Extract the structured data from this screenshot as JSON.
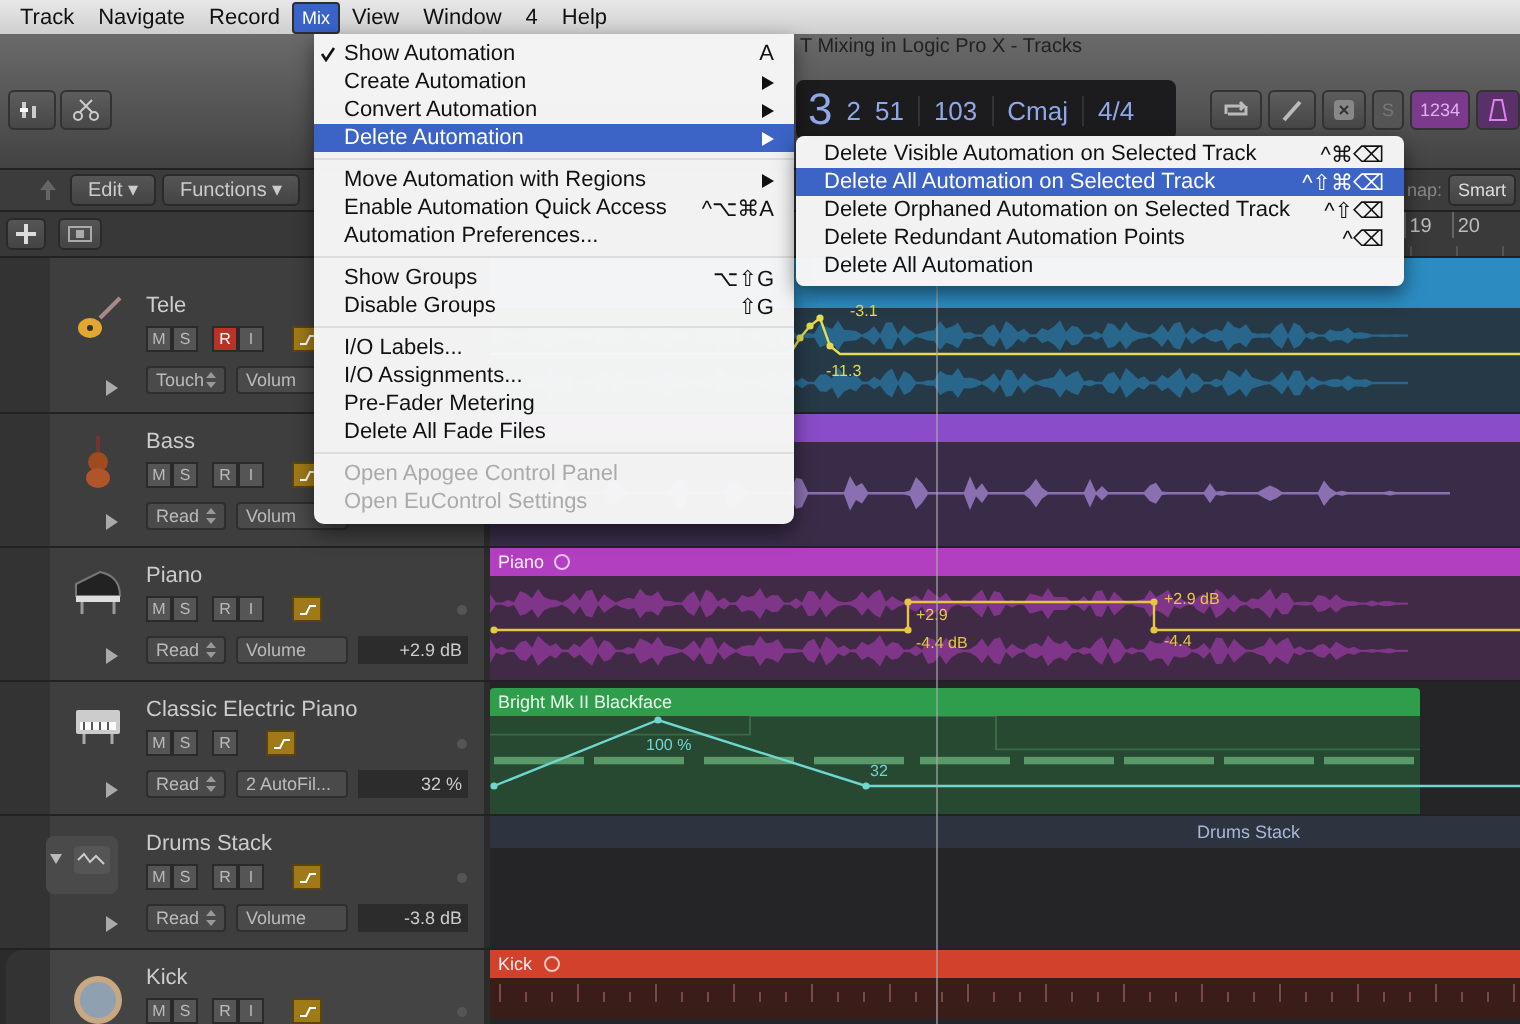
{
  "menu_bar": [
    {
      "label": "Track",
      "selected": false
    },
    {
      "label": "Navigate",
      "selected": false
    },
    {
      "label": "Record",
      "selected": false
    },
    {
      "label": "Mix",
      "selected": true
    },
    {
      "label": "View",
      "selected": false
    },
    {
      "label": "Window",
      "selected": false
    },
    {
      "label": "4",
      "selected": false
    },
    {
      "label": "Help",
      "selected": false
    }
  ],
  "window": {
    "title": "T Mixing in Logic Pro X - Tracks"
  },
  "lcd": {
    "bar": "3",
    "beat": "2",
    "division": "51",
    "tempo": "103",
    "key": "Cmaj",
    "signature": "4/4"
  },
  "toolbar": {
    "solo": "S",
    "count_in": "1234"
  },
  "edit_bar": {
    "menus": [
      "Edit ▾",
      "Functions ▾"
    ],
    "snap_label": "nap:",
    "snap_value": "Smart"
  },
  "ruler": {
    "marks": [
      "19",
      "20"
    ]
  },
  "tracks": [
    {
      "name": "Tele",
      "buttons": [
        {
          "label": "M",
          "on": false
        },
        {
          "label": "S",
          "on": false
        },
        {
          "label": "R",
          "on": true
        },
        {
          "label": "I",
          "on": false
        }
      ],
      "mode": "Touch",
      "parameter": "Volum",
      "region": {
        "kind": "stereo",
        "color": "#2c8cc2"
      },
      "automation_labels": [
        "-3.1",
        "-11.3"
      ]
    },
    {
      "name": "Bass",
      "buttons": [
        {
          "label": "M",
          "on": false
        },
        {
          "label": "S",
          "on": false
        },
        {
          "label": "R",
          "on": false
        },
        {
          "label": "I",
          "on": false
        }
      ],
      "mode": "Read",
      "parameter": "Volum",
      "region": {
        "kind": "mono",
        "color": "#8a4cc8"
      }
    },
    {
      "name": "Piano",
      "buttons": [
        {
          "label": "M",
          "on": false
        },
        {
          "label": "S",
          "on": false
        },
        {
          "label": "R",
          "on": false
        },
        {
          "label": "I",
          "on": false
        }
      ],
      "mode": "Read",
      "parameter": "Volume",
      "value": "+2.9 dB",
      "region": {
        "kind": "stereo",
        "color": "#b23fc0",
        "name": "Piano"
      },
      "automation_labels": [
        "+2.9",
        "-4.4 dB",
        "+2.9 dB",
        "-4.4"
      ]
    },
    {
      "name": "Classic Electric Piano",
      "buttons": [
        {
          "label": "M",
          "on": false
        },
        {
          "label": "S",
          "on": false
        },
        {
          "label": "R",
          "on": false
        }
      ],
      "mode": "Read",
      "parameter": "2 AutoFil...",
      "value": "32 %",
      "region": {
        "kind": "midi",
        "color": "#2f9e4c",
        "name": "Bright Mk II Blackface"
      },
      "automation_labels": [
        "100 %",
        "32"
      ]
    },
    {
      "name": "Drums Stack",
      "expanded": true,
      "buttons": [
        {
          "label": "M",
          "on": false
        },
        {
          "label": "S",
          "on": false
        },
        {
          "label": "R",
          "on": false
        },
        {
          "label": "I",
          "on": false
        }
      ],
      "mode": "Read",
      "parameter": "Volume",
      "value": "-3.8 dB",
      "region": {
        "kind": "summary",
        "name": "Drums Stack"
      }
    },
    {
      "name": "Kick",
      "buttons": [
        {
          "label": "M",
          "on": false
        },
        {
          "label": "S",
          "on": false
        },
        {
          "label": "R",
          "on": false
        },
        {
          "label": "I",
          "on": false
        }
      ],
      "region": {
        "kind": "kick",
        "color": "#d2412b",
        "name": "Kick"
      }
    }
  ],
  "mix_menu": [
    [
      {
        "label": "Show Automation",
        "checked": true,
        "shortcut": "A",
        "submenu": false,
        "disabled": false,
        "selected": false
      },
      {
        "label": "Create Automation",
        "checked": false,
        "submenu": true,
        "disabled": false,
        "selected": false
      },
      {
        "label": "Convert Automation",
        "checked": false,
        "submenu": true,
        "disabled": false,
        "selected": false
      },
      {
        "label": "Delete Automation",
        "checked": false,
        "submenu": true,
        "disabled": false,
        "selected": true
      }
    ],
    [
      {
        "label": "Move Automation with Regions",
        "checked": false,
        "submenu": true,
        "disabled": false,
        "selected": false
      },
      {
        "label": "Enable Automation Quick Access",
        "checked": false,
        "shortcut": "^⌥⌘A",
        "submenu": false,
        "disabled": false,
        "selected": false
      },
      {
        "label": "Automation Preferences...",
        "checked": false,
        "submenu": false,
        "disabled": false,
        "selected": false
      }
    ],
    [
      {
        "label": "Show Groups",
        "checked": false,
        "shortcut": "⌥⇧G",
        "submenu": false,
        "disabled": false,
        "selected": false
      },
      {
        "label": "Disable Groups",
        "checked": false,
        "shortcut": "⇧G",
        "submenu": false,
        "disabled": false,
        "selected": false
      }
    ],
    [
      {
        "label": "I/O Labels...",
        "checked": false,
        "submenu": false,
        "disabled": false,
        "selected": false
      },
      {
        "label": "I/O Assignments...",
        "checked": false,
        "submenu": false,
        "disabled": false,
        "selected": false
      },
      {
        "label": "Pre-Fader Metering",
        "checked": false,
        "submenu": false,
        "disabled": false,
        "selected": false
      },
      {
        "label": "Delete All Fade Files",
        "checked": false,
        "submenu": false,
        "disabled": false,
        "selected": false
      }
    ],
    [
      {
        "label": "Open Apogee Control Panel",
        "checked": false,
        "submenu": false,
        "disabled": true,
        "selected": false
      },
      {
        "label": "Open EuControl Settings",
        "checked": false,
        "submenu": false,
        "disabled": true,
        "selected": false
      }
    ]
  ],
  "delete_submenu": [
    {
      "label": "Delete Visible Automation on Selected Track",
      "shortcut": "^⌘⌫",
      "selected": false
    },
    {
      "label": "Delete All Automation on Selected Track",
      "shortcut": "^⇧⌘⌫",
      "selected": true
    },
    {
      "label": "Delete Orphaned Automation on Selected Track",
      "shortcut": "^⇧⌫",
      "selected": false
    },
    {
      "label": "Delete Redundant Automation Points",
      "shortcut": "^⌫",
      "selected": false
    },
    {
      "label": "Delete All Automation",
      "selected": false
    }
  ]
}
